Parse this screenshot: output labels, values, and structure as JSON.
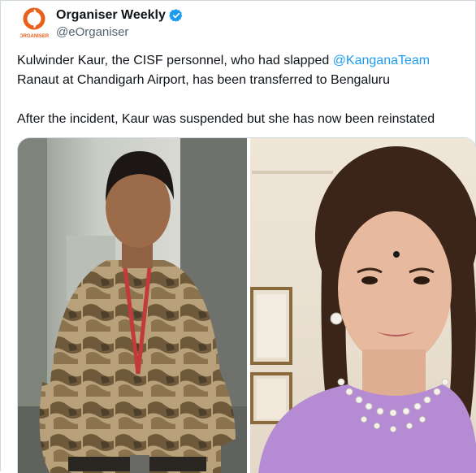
{
  "author": {
    "display_name": "Organiser Weekly",
    "handle": "@eOrganiser",
    "avatar_logo_text": "ORGANISER",
    "verified_color": "#1d9bf0"
  },
  "tweet": {
    "line1_before": "Kulwinder Kaur, the CISF personnel, who had slapped ",
    "mention": "@KanganaTeam",
    "line1_after": " Ranaut at Chandigarh Airport, has been transferred to Bengaluru",
    "paragraph2": "After the incident, Kaur was suspended but she has now been reinstated"
  },
  "media": {
    "left_photo": "cisf-officer-photo",
    "right_photo": "kangana-ranaut-photo"
  },
  "colors": {
    "text": "#0f1419",
    "secondary": "#536471",
    "link": "#1d9bf0",
    "border": "#cfd9de",
    "brand_orange": "#e8601c"
  }
}
